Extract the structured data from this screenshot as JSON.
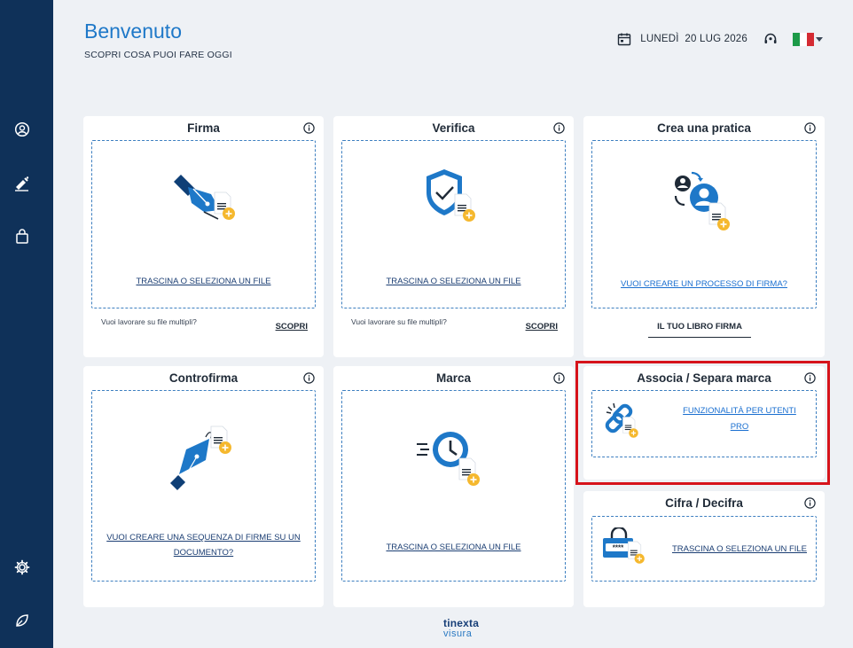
{
  "header": {
    "title": "Benvenuto",
    "subtitle": "SCOPRI COSA PUOI FARE OGGI",
    "date": "LUNEDÌ  20 LUG 2026"
  },
  "sidebar": {
    "items": [
      "user-icon",
      "sign-pen-icon",
      "bag-icon",
      "settings-icon",
      "leaf-icon"
    ]
  },
  "cards": {
    "firma": {
      "title": "Firma",
      "link": "TRASCINA O SELEZIONA UN FILE",
      "extra": "Vuoi lavorare su file multipli?",
      "scopri": "SCOPRI"
    },
    "verifica": {
      "title": "Verifica",
      "link": "TRASCINA O SELEZIONA UN FILE",
      "extra": "Vuoi lavorare su file multipli?",
      "scopri": "SCOPRI"
    },
    "pratica": {
      "title": "Crea una pratica",
      "link": "VUOI CREARE UN PROCESSO DI FIRMA?",
      "libro": "IL TUO LIBRO FIRMA"
    },
    "controfirma": {
      "title": "Controfirma",
      "link_line1": "VUOI CREARE UNA SEQUENZA DI FIRME SU UN",
      "link_line2": "DOCUMENTO?"
    },
    "marca": {
      "title": "Marca",
      "link": "TRASCINA O SELEZIONA UN FILE"
    },
    "associa": {
      "title": "Associa / Separa marca",
      "link_line1": "FUNZIONALITÀ PER UTENTI",
      "link_line2": "PRO"
    },
    "cifra": {
      "title": "Cifra / Decifra",
      "link": "TRASCINA O SELEZIONA UN FILE",
      "pin": "****"
    }
  },
  "footer": {
    "logo_line1": "tinexta",
    "logo_line2": "visura"
  },
  "colors": {
    "sidebar": "#0f3159",
    "accent": "#1e78c8",
    "highlight": "#d6131b",
    "plus": "#f5b82e"
  }
}
